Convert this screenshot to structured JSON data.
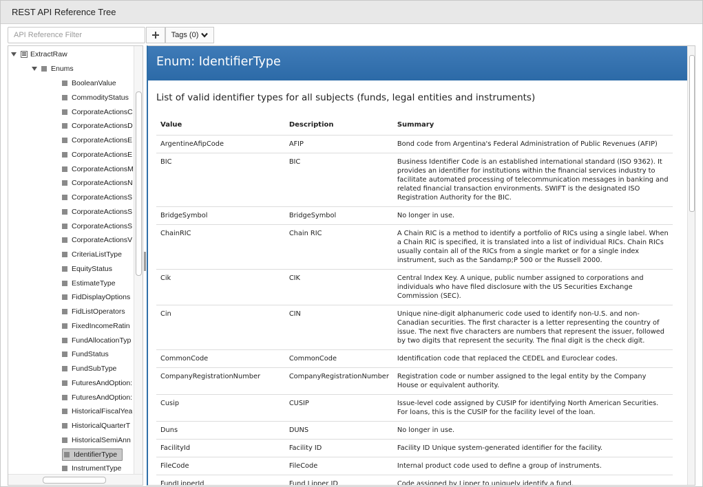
{
  "window": {
    "title": "REST API Reference Tree"
  },
  "toolbar": {
    "filter_placeholder": "API Reference Filter",
    "add_icon": "plus-icon",
    "tags_label": "Tags (0)",
    "tags_icon": "chevron-down-icon"
  },
  "tree": {
    "root": {
      "label": "ExtractRaw",
      "icon": "module-icon"
    },
    "group": {
      "label": "Enums"
    },
    "items": [
      {
        "label": "BooleanValue"
      },
      {
        "label": "CommodityStatus"
      },
      {
        "label": "CorporateActionsC"
      },
      {
        "label": "CorporateActionsD"
      },
      {
        "label": "CorporateActionsE"
      },
      {
        "label": "CorporateActionsE"
      },
      {
        "label": "CorporateActionsM"
      },
      {
        "label": "CorporateActionsN"
      },
      {
        "label": "CorporateActionsS"
      },
      {
        "label": "CorporateActionsS"
      },
      {
        "label": "CorporateActionsS"
      },
      {
        "label": "CorporateActionsV"
      },
      {
        "label": "CriteriaListType"
      },
      {
        "label": "EquityStatus"
      },
      {
        "label": "EstimateType"
      },
      {
        "label": "FidDisplayOptions"
      },
      {
        "label": "FidListOperators"
      },
      {
        "label": "FixedIncomeRatin"
      },
      {
        "label": "FundAllocationTyp"
      },
      {
        "label": "FundStatus"
      },
      {
        "label": "FundSubType"
      },
      {
        "label": "FuturesAndOption:"
      },
      {
        "label": "FuturesAndOption:"
      },
      {
        "label": "HistoricalFiscalYea"
      },
      {
        "label": "HistoricalQuarterT"
      },
      {
        "label": "HistoricalSemiAnn"
      },
      {
        "label": "IdentifierType",
        "selected": true
      },
      {
        "label": "InstrumentType"
      }
    ]
  },
  "content": {
    "heading": "Enum: IdentifierType",
    "description": "List of valid identifier types for all subjects (funds, legal entities and instruments)",
    "table": {
      "headers": [
        "Value",
        "Description",
        "Summary"
      ],
      "rows": [
        {
          "value": "ArgentineAfipCode",
          "description": "AFIP",
          "summary": "Bond code from Argentina's Federal Administration of Public Revenues (AFIP)"
        },
        {
          "value": "BIC",
          "description": "BIC",
          "summary": "Business Identifier Code is an established international standard (ISO 9362). It provides an identifier for institutions within the financial services industry to facilitate automated processing of telecommunication messages in banking and related financial transaction environments. SWIFT is the designated ISO Registration Authority for the BIC."
        },
        {
          "value": "BridgeSymbol",
          "description": "BridgeSymbol",
          "summary": "No longer in use."
        },
        {
          "value": "ChainRIC",
          "description": "Chain RIC",
          "summary": "A Chain RIC is a method to identify a portfolio of RICs using a single label. When a Chain RIC is specified, it is translated into a list of individual RICs. Chain RICs usually contain all of the RICs from a single market or for a single index instrument, such as the Sandamp;P 500 or the Russell 2000."
        },
        {
          "value": "Cik",
          "description": "CIK",
          "summary": "Central Index Key. A unique, public number assigned to corporations and individuals who have filed disclosure with the US Securities Exchange Commission (SEC)."
        },
        {
          "value": "Cin",
          "description": "CIN",
          "summary": "Unique nine-digit alphanumeric code used to identify non-U.S. and non-Canadian securities. The first character is a letter representing the country of issue. The next five characters are numbers that represent the issuer, followed by two digits that represent the security. The final digit is the check digit."
        },
        {
          "value": "CommonCode",
          "description": "CommonCode",
          "summary": "Identification code that replaced the CEDEL and Euroclear codes."
        },
        {
          "value": "CompanyRegistrationNumber",
          "description": "CompanyRegistrationNumber",
          "summary": "Registration code or number assigned to the legal entity by the Company House or equivalent authority."
        },
        {
          "value": "Cusip",
          "description": "CUSIP",
          "summary": "Issue-level code assigned by CUSIP for identifying North American Securities. For loans, this is the CUSIP for the facility level of the loan."
        },
        {
          "value": "Duns",
          "description": "DUNS",
          "summary": "No longer in use."
        },
        {
          "value": "FacilityId",
          "description": "Facility ID",
          "summary": "Facility ID Unique system-generated identifier for the facility."
        },
        {
          "value": "FileCode",
          "description": "FileCode",
          "summary": "Internal product code used to define a group of instruments."
        },
        {
          "value": "FundLipperId",
          "description": "Fund Lipper ID",
          "summary": "Code assigned by Lipper to uniquely identify a fund."
        }
      ]
    }
  },
  "colors": {
    "header_band": "#2f6fa8",
    "selection": "#c9c9c9"
  }
}
